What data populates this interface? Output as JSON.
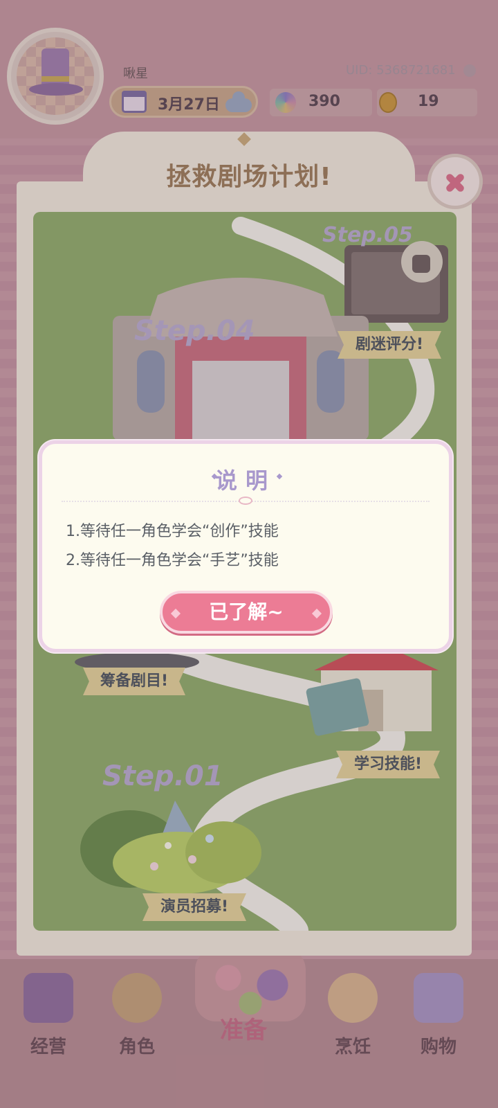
{
  "profile": {
    "name": "啾星",
    "uid": "UID: 5368721681",
    "date": "3月27日",
    "gems": "390",
    "coins": "19"
  },
  "plan": {
    "title": "拯救剧场计划!",
    "steps": {
      "step05_label": "Step.05",
      "step05_task": "剧迷评分!",
      "step04_label": "Step.04",
      "step03_task": "筹备剧目!",
      "step02_task": "学习技能!",
      "step01_label": "Step.01",
      "step01_task": "演员招募!"
    }
  },
  "dialog": {
    "title": "说明",
    "line1": "1.等待任一角色学会“创作”技能",
    "line2": "2.等待任一角色学会“手艺”技能",
    "confirm": "已了解~"
  },
  "nav": {
    "operate": "经营",
    "character": "角色",
    "prepare": "准备",
    "cooking": "烹饪",
    "shopping": "购物"
  },
  "colors": {
    "accent_pink": "#ec7c95",
    "title_lavender": "#a898cc",
    "map_green": "#8fab6b",
    "ribbon_yellow": "#e3d19a"
  }
}
